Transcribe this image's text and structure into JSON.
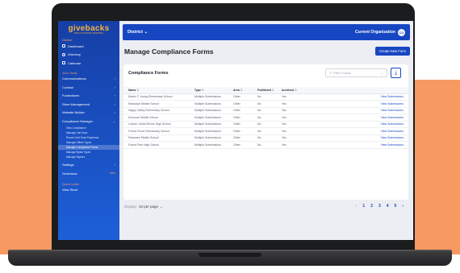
{
  "sidebar": {
    "logo": "givebacks",
    "logo_sub": "BACK TO SCHOOL SHOPPING",
    "section_main": "District",
    "main_items": [
      {
        "label": "Dashboard",
        "icon": "grid-icon"
      },
      {
        "label": "Directory",
        "icon": "people-icon"
      },
      {
        "label": "Calendar",
        "icon": "calendar-icon"
      }
    ],
    "section_tools": "Your Tools",
    "tools": [
      {
        "label": "Communications"
      },
      {
        "label": "Contact"
      },
      {
        "label": "Fundraisers"
      },
      {
        "label": "Store Management"
      },
      {
        "label": "Website Builder"
      },
      {
        "label": "Compliance Manager"
      }
    ],
    "compliance_sub": [
      {
        "label": "View Compliance",
        "active": false
      },
      {
        "label": "Manage Unit Dues",
        "active": false
      },
      {
        "label": "Record Unit Dues Payments",
        "active": false
      },
      {
        "label": "Manage Officer Types",
        "active": false
      },
      {
        "label": "Manage Compliance Forms",
        "active": true
      },
      {
        "label": "Manage Bylaw Types",
        "active": false
      },
      {
        "label": "Manage Signers",
        "active": false
      }
    ],
    "bottom_items": [
      {
        "label": "Settings"
      },
      {
        "label": "Givebacks",
        "badge": "New"
      }
    ],
    "section_quick": "Quick Links",
    "quick_items": [
      {
        "label": "View Store"
      }
    ]
  },
  "topbar": {
    "district_label": "District",
    "org_label": "Current Organization",
    "avatar_initials": "CO"
  },
  "page": {
    "title": "Manage Compliance Forms",
    "create_button": "Create New Form"
  },
  "table_card": {
    "title": "Compliance Forms",
    "filter_placeholder": "Filter Forms",
    "columns": [
      "Name",
      "Type",
      "Area",
      "Published",
      "Archived",
      ""
    ],
    "rows": [
      {
        "name": "Martin F. Young Elementary School",
        "type": "Multiple Submissions",
        "area": "Other",
        "published": "No",
        "archived": "Yes",
        "action": "View Submissions"
      },
      {
        "name": "Randolph Middle School",
        "type": "Multiple Submissions",
        "area": "Other",
        "published": "No",
        "archived": "Yes",
        "action": "View Submissions"
      },
      {
        "name": "Happy Valley Elementary School",
        "type": "Multiple Submissions",
        "area": "Other",
        "published": "No",
        "archived": "Yes",
        "action": "View Submissions"
      },
      {
        "name": "Donovan Middle School",
        "type": "Multiple Submissions",
        "area": "Other",
        "published": "No",
        "archived": "Yes",
        "action": "View Submissions"
      },
      {
        "name": "Lincoln Junior/Senior High School",
        "type": "Multiple Submissions",
        "area": "Other",
        "published": "No",
        "archived": "Yes",
        "action": "View Submissions"
      },
      {
        "name": "Forest Grove Elementary School",
        "type": "Multiple Submissions",
        "area": "Other",
        "published": "No",
        "archived": "Yes",
        "action": "View Submissions"
      },
      {
        "name": "Delaware Middle School",
        "type": "Multiple Submissions",
        "area": "Other",
        "published": "No",
        "archived": "Yes",
        "action": "View Submissions"
      },
      {
        "name": "Forest Park High School",
        "type": "Multiple Submissions",
        "area": "Other",
        "published": "No",
        "archived": "Yes",
        "action": "View Submissions"
      }
    ]
  },
  "footer": {
    "display_label": "Display:",
    "per_page": "10 per page",
    "pages": [
      "1",
      "2",
      "3",
      "4",
      "5"
    ],
    "prev": "‹",
    "next": "›"
  }
}
